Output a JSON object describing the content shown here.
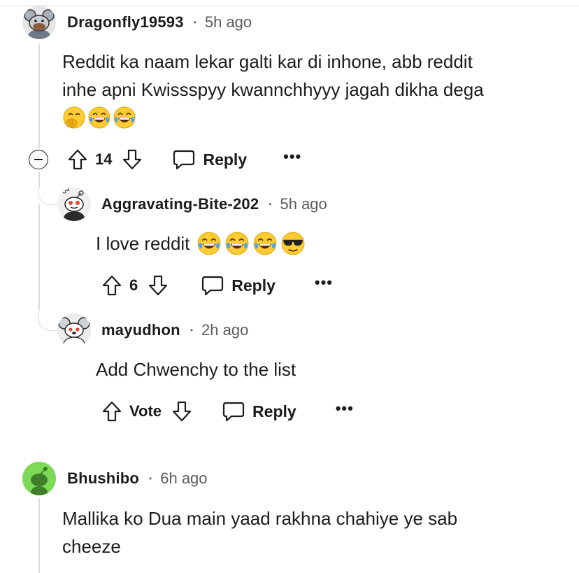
{
  "comments": [
    {
      "author": "Dragonfly19593",
      "time": "5h ago",
      "separator": "•",
      "body_lines": [
        "Reddit ka naam lekar galti kar di inhone, abb reddit",
        "inhe apni Kwissspyy kwannchhyyy jagah dikha dega"
      ],
      "emojis": [
        "hand-over-mouth",
        "tears-of-joy",
        "tears-of-joy"
      ],
      "votes": "14",
      "reply_label": "Reply",
      "more_label": "•••",
      "avatar_color": "#e3e3e3"
    },
    {
      "author": "Aggravating-Bite-202",
      "time": "5h ago",
      "separator": "•",
      "body": "I love reddit",
      "emojis": [
        "tears-of-joy",
        "tears-of-joy",
        "tears-of-joy",
        "sunglasses"
      ],
      "votes": "6",
      "reply_label": "Reply",
      "more_label": "•••",
      "avatar_color": "#eeeeee"
    },
    {
      "author": "mayudhon",
      "time": "2h ago",
      "separator": "•",
      "body": "Add Chwenchy to the list",
      "votes": "Vote",
      "reply_label": "Reply",
      "more_label": "•••",
      "avatar_color": "#e3e3e3"
    },
    {
      "author": "Bhushibo",
      "time": "6h ago",
      "separator": "•",
      "body_lines": [
        "Mallika ko Dua main yaad rakhna chahiye ye sab",
        "cheeze"
      ],
      "avatar_color": "#7ed957"
    }
  ],
  "colors": {
    "text": "#1c1c1c",
    "meta": "#5c5c5c",
    "thread_line": "#dcdcdc",
    "emoji_yellow": "#ffcc33",
    "tear_blue": "#3ba5ff"
  }
}
